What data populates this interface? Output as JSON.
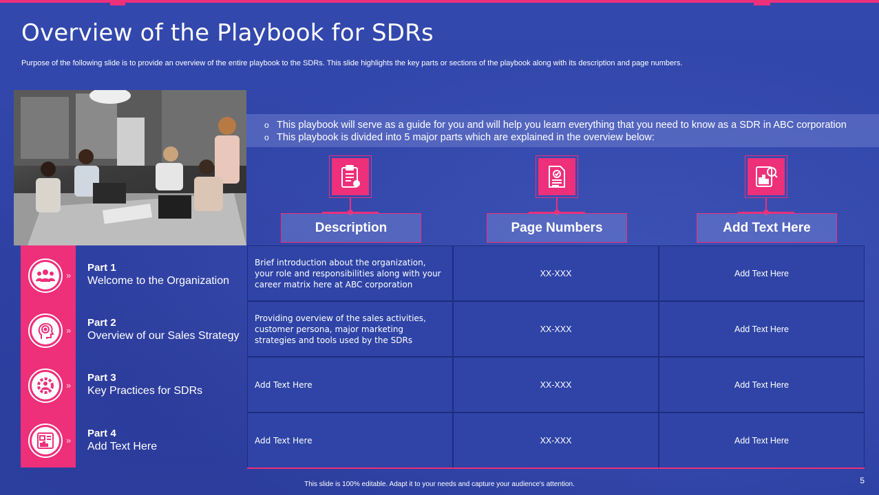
{
  "title": "Overview of the Playbook for SDRs",
  "subtitle": "Purpose of the following slide is to provide an overview of the entire playbook to the SDRs. This slide highlights the key parts or sections of the playbook along with its description and page numbers.",
  "bullets": [
    "This playbook will serve as a guide for you and will help you learn everything that you need to know as a SDR in ABC corporation",
    "This playbook is divided into 5 major parts which are explained in the overview below:"
  ],
  "columns": [
    {
      "label": "Description",
      "icon": "clipboard-icon"
    },
    {
      "label": "Page Numbers",
      "icon": "document-check-icon"
    },
    {
      "label": "Add Text Here",
      "icon": "report-search-icon"
    }
  ],
  "parts": [
    {
      "part": "Part 1",
      "title": "Welcome to the Organization",
      "icon": "team-icon",
      "description": "Brief introduction about the organization, your role and responsibilities along with your career matrix here at ABC corporation",
      "pages": "XX-XXX",
      "extra": "Add Text Here"
    },
    {
      "part": "Part 2",
      "title": "Overview  of our Sales Strategy",
      "icon": "head-target-icon",
      "description": "Providing overview  of the sales activities, customer persona, major marketing strategies and tools used by the SDRs",
      "pages": "XX-XXX",
      "extra": "Add Text Here"
    },
    {
      "part": "Part 3",
      "title": "Key Practices for SDRs",
      "icon": "gear-person-icon",
      "description": "Add Text Here",
      "pages": "XX-XXX",
      "extra": "Add Text Here"
    },
    {
      "part": "Part 4",
      "title": "Add Text Here",
      "icon": "report-chart-icon",
      "description": "Add Text Here",
      "pages": "XX-XXX",
      "extra": "Add Text Here"
    }
  ],
  "footer": "This slide is 100% editable.  Adapt it to your needs and capture your audience's attention.",
  "page_number": "5",
  "colors": {
    "background": "#2f44a6",
    "accent": "#ee2f7a",
    "bullet_band": "#7887d2"
  }
}
